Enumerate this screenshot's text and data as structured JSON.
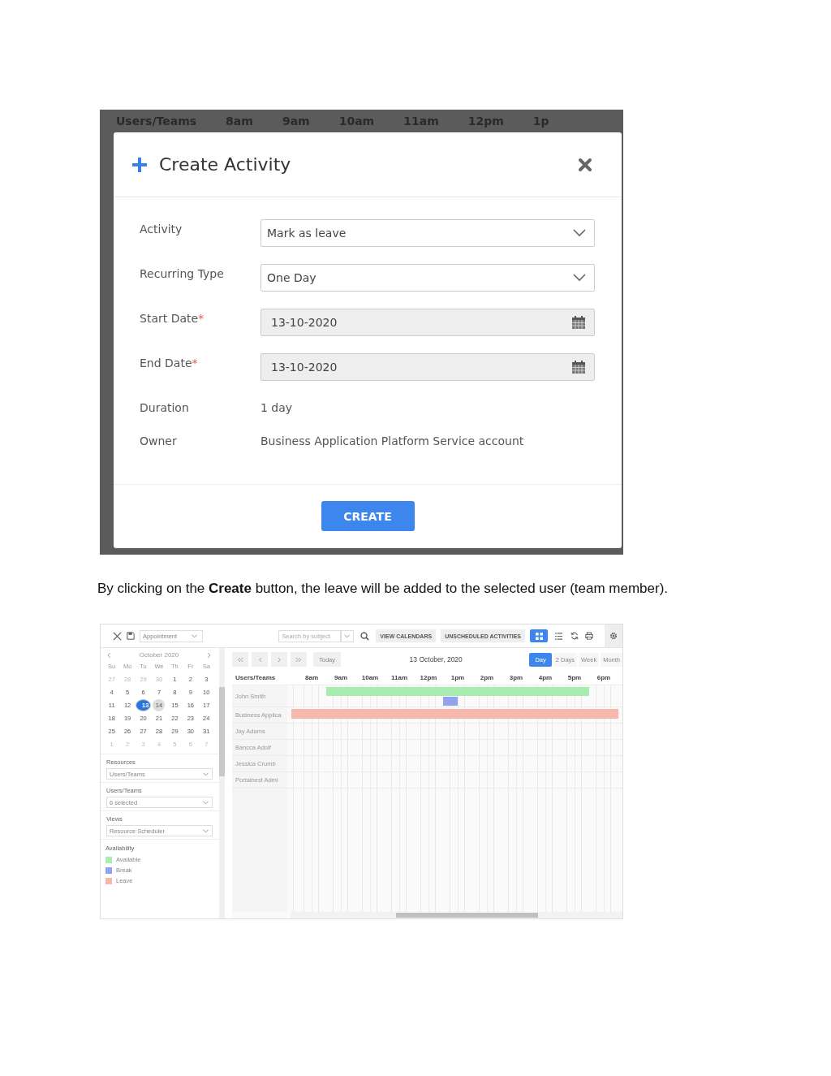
{
  "dialog_screenshot": {
    "background_header": [
      "Users/Teams",
      "8am",
      "9am",
      "10am",
      "11am",
      "12pm",
      "1p"
    ],
    "title": "Create Activity",
    "required_mark": "*",
    "fields": [
      {
        "label": "Activity",
        "kind": "select",
        "value": "Mark as leave",
        "required": false
      },
      {
        "label": "Recurring Type",
        "kind": "select",
        "value": "One Day",
        "required": false
      },
      {
        "label": "Start Date",
        "kind": "date",
        "value": "13-10-2020",
        "required": true
      },
      {
        "label": "End Date",
        "kind": "date",
        "value": "13-10-2020",
        "required": true
      },
      {
        "label": "Duration",
        "kind": "text",
        "value": "1 day",
        "required": false
      },
      {
        "label": "Owner",
        "kind": "text",
        "value": "Business Application Platform Service account",
        "required": false
      }
    ],
    "button": "CREATE"
  },
  "caption": "By clicking on the **Create** button, the leave will be added to the selected user (team member).",
  "scheduler_screenshot": {
    "toolbar": {
      "activity_type": "Appointment",
      "search": {
        "placeholder": "Search by subject"
      },
      "buttons": [
        "VIEW CALENDARS",
        "UNSCHEDULED ACTIVITIES"
      ],
      "view_toggle": [
        {
          "kind": "grid",
          "selected": true
        },
        {
          "kind": "list",
          "selected": false
        }
      ]
    },
    "mini_calendar": {
      "month": "October 2020",
      "weekdays": [
        "Su",
        "Mo",
        "Tu",
        "We",
        "Th",
        "Fr",
        "Sa"
      ],
      "weeks": [
        [
          {
            "d": "27",
            "out": true,
            "selected": false,
            "today": false
          },
          {
            "d": "28",
            "out": true,
            "selected": false,
            "today": false
          },
          {
            "d": "29",
            "out": true,
            "selected": false,
            "today": false
          },
          {
            "d": "30",
            "out": true,
            "selected": false,
            "today": false
          },
          {
            "d": "1",
            "out": false,
            "selected": false,
            "today": false
          },
          {
            "d": "2",
            "out": false,
            "selected": false,
            "today": false
          },
          {
            "d": "3",
            "out": false,
            "selected": false,
            "today": false
          }
        ],
        [
          {
            "d": "4",
            "out": false,
            "selected": false,
            "today": false
          },
          {
            "d": "5",
            "out": false,
            "selected": false,
            "today": false
          },
          {
            "d": "6",
            "out": false,
            "selected": false,
            "today": false
          },
          {
            "d": "7",
            "out": false,
            "selected": false,
            "today": false
          },
          {
            "d": "8",
            "out": false,
            "selected": false,
            "today": false
          },
          {
            "d": "9",
            "out": false,
            "selected": false,
            "today": false
          },
          {
            "d": "10",
            "out": false,
            "selected": false,
            "today": false
          }
        ],
        [
          {
            "d": "11",
            "out": false,
            "selected": false,
            "today": false
          },
          {
            "d": "12",
            "out": false,
            "selected": false,
            "today": false
          },
          {
            "d": "13",
            "out": false,
            "selected": true,
            "today": false
          },
          {
            "d": "14",
            "out": false,
            "selected": false,
            "today": true
          },
          {
            "d": "15",
            "out": false,
            "selected": false,
            "today": false
          },
          {
            "d": "16",
            "out": false,
            "selected": false,
            "today": false
          },
          {
            "d": "17",
            "out": false,
            "selected": false,
            "today": false
          }
        ],
        [
          {
            "d": "18",
            "out": false,
            "selected": false,
            "today": false
          },
          {
            "d": "19",
            "out": false,
            "selected": false,
            "today": false
          },
          {
            "d": "20",
            "out": false,
            "selected": false,
            "today": false
          },
          {
            "d": "21",
            "out": false,
            "selected": false,
            "today": false
          },
          {
            "d": "22",
            "out": false,
            "selected": false,
            "today": false
          },
          {
            "d": "23",
            "out": false,
            "selected": false,
            "today": false
          },
          {
            "d": "24",
            "out": false,
            "selected": false,
            "today": false
          }
        ],
        [
          {
            "d": "25",
            "out": false,
            "selected": false,
            "today": false
          },
          {
            "d": "26",
            "out": false,
            "selected": false,
            "today": false
          },
          {
            "d": "27",
            "out": false,
            "selected": false,
            "today": false
          },
          {
            "d": "28",
            "out": false,
            "selected": false,
            "today": false
          },
          {
            "d": "29",
            "out": false,
            "selected": false,
            "today": false
          },
          {
            "d": "30",
            "out": false,
            "selected": false,
            "today": false
          },
          {
            "d": "31",
            "out": false,
            "selected": false,
            "today": false
          }
        ],
        [
          {
            "d": "1",
            "out": true,
            "selected": false,
            "today": false
          },
          {
            "d": "2",
            "out": true,
            "selected": false,
            "today": false
          },
          {
            "d": "3",
            "out": true,
            "selected": false,
            "today": false
          },
          {
            "d": "4",
            "out": true,
            "selected": false,
            "today": false
          },
          {
            "d": "5",
            "out": true,
            "selected": false,
            "today": false
          },
          {
            "d": "6",
            "out": true,
            "selected": false,
            "today": false
          },
          {
            "d": "7",
            "out": true,
            "selected": false,
            "today": false
          }
        ]
      ]
    },
    "filters": [
      {
        "label": "Resources",
        "value": "Users/Teams"
      },
      {
        "label": "Users/Teams",
        "value": "6 selected"
      },
      {
        "label": "Views",
        "value": "Resource Scheduler"
      }
    ],
    "availability": {
      "title": "Availability",
      "items": [
        {
          "label": "Available",
          "kind": "available",
          "color": "#a8ecb0"
        },
        {
          "label": "Break",
          "kind": "break",
          "color": "#8fa3ee"
        },
        {
          "label": "Leave",
          "kind": "leave",
          "color": "#f6b8ad"
        }
      ]
    },
    "nav": {
      "today": "Today",
      "date": "13 October, 2020",
      "views": [
        {
          "label": "Day",
          "selected": true
        },
        {
          "label": "2 Days",
          "selected": false
        },
        {
          "label": "Week",
          "selected": false
        },
        {
          "label": "Month",
          "selected": false
        }
      ]
    },
    "grid": {
      "header": "Users/Teams",
      "hours": [
        "8am",
        "9am",
        "10am",
        "11am",
        "12pm",
        "1pm",
        "2pm",
        "3pm",
        "4pm",
        "5pm",
        "6pm"
      ],
      "rows": [
        {
          "name": "John Smith",
          "events": [
            {
              "kind": "available"
            },
            {
              "kind": "break"
            }
          ]
        },
        {
          "name": "Business Applica",
          "events": [
            {
              "kind": "leave"
            }
          ]
        },
        {
          "name": "Jay Adams",
          "events": []
        },
        {
          "name": "Bancca Adolf",
          "events": []
        },
        {
          "name": "Jessica Crumb",
          "events": []
        },
        {
          "name": "Portalnest Admi",
          "events": []
        }
      ]
    }
  }
}
